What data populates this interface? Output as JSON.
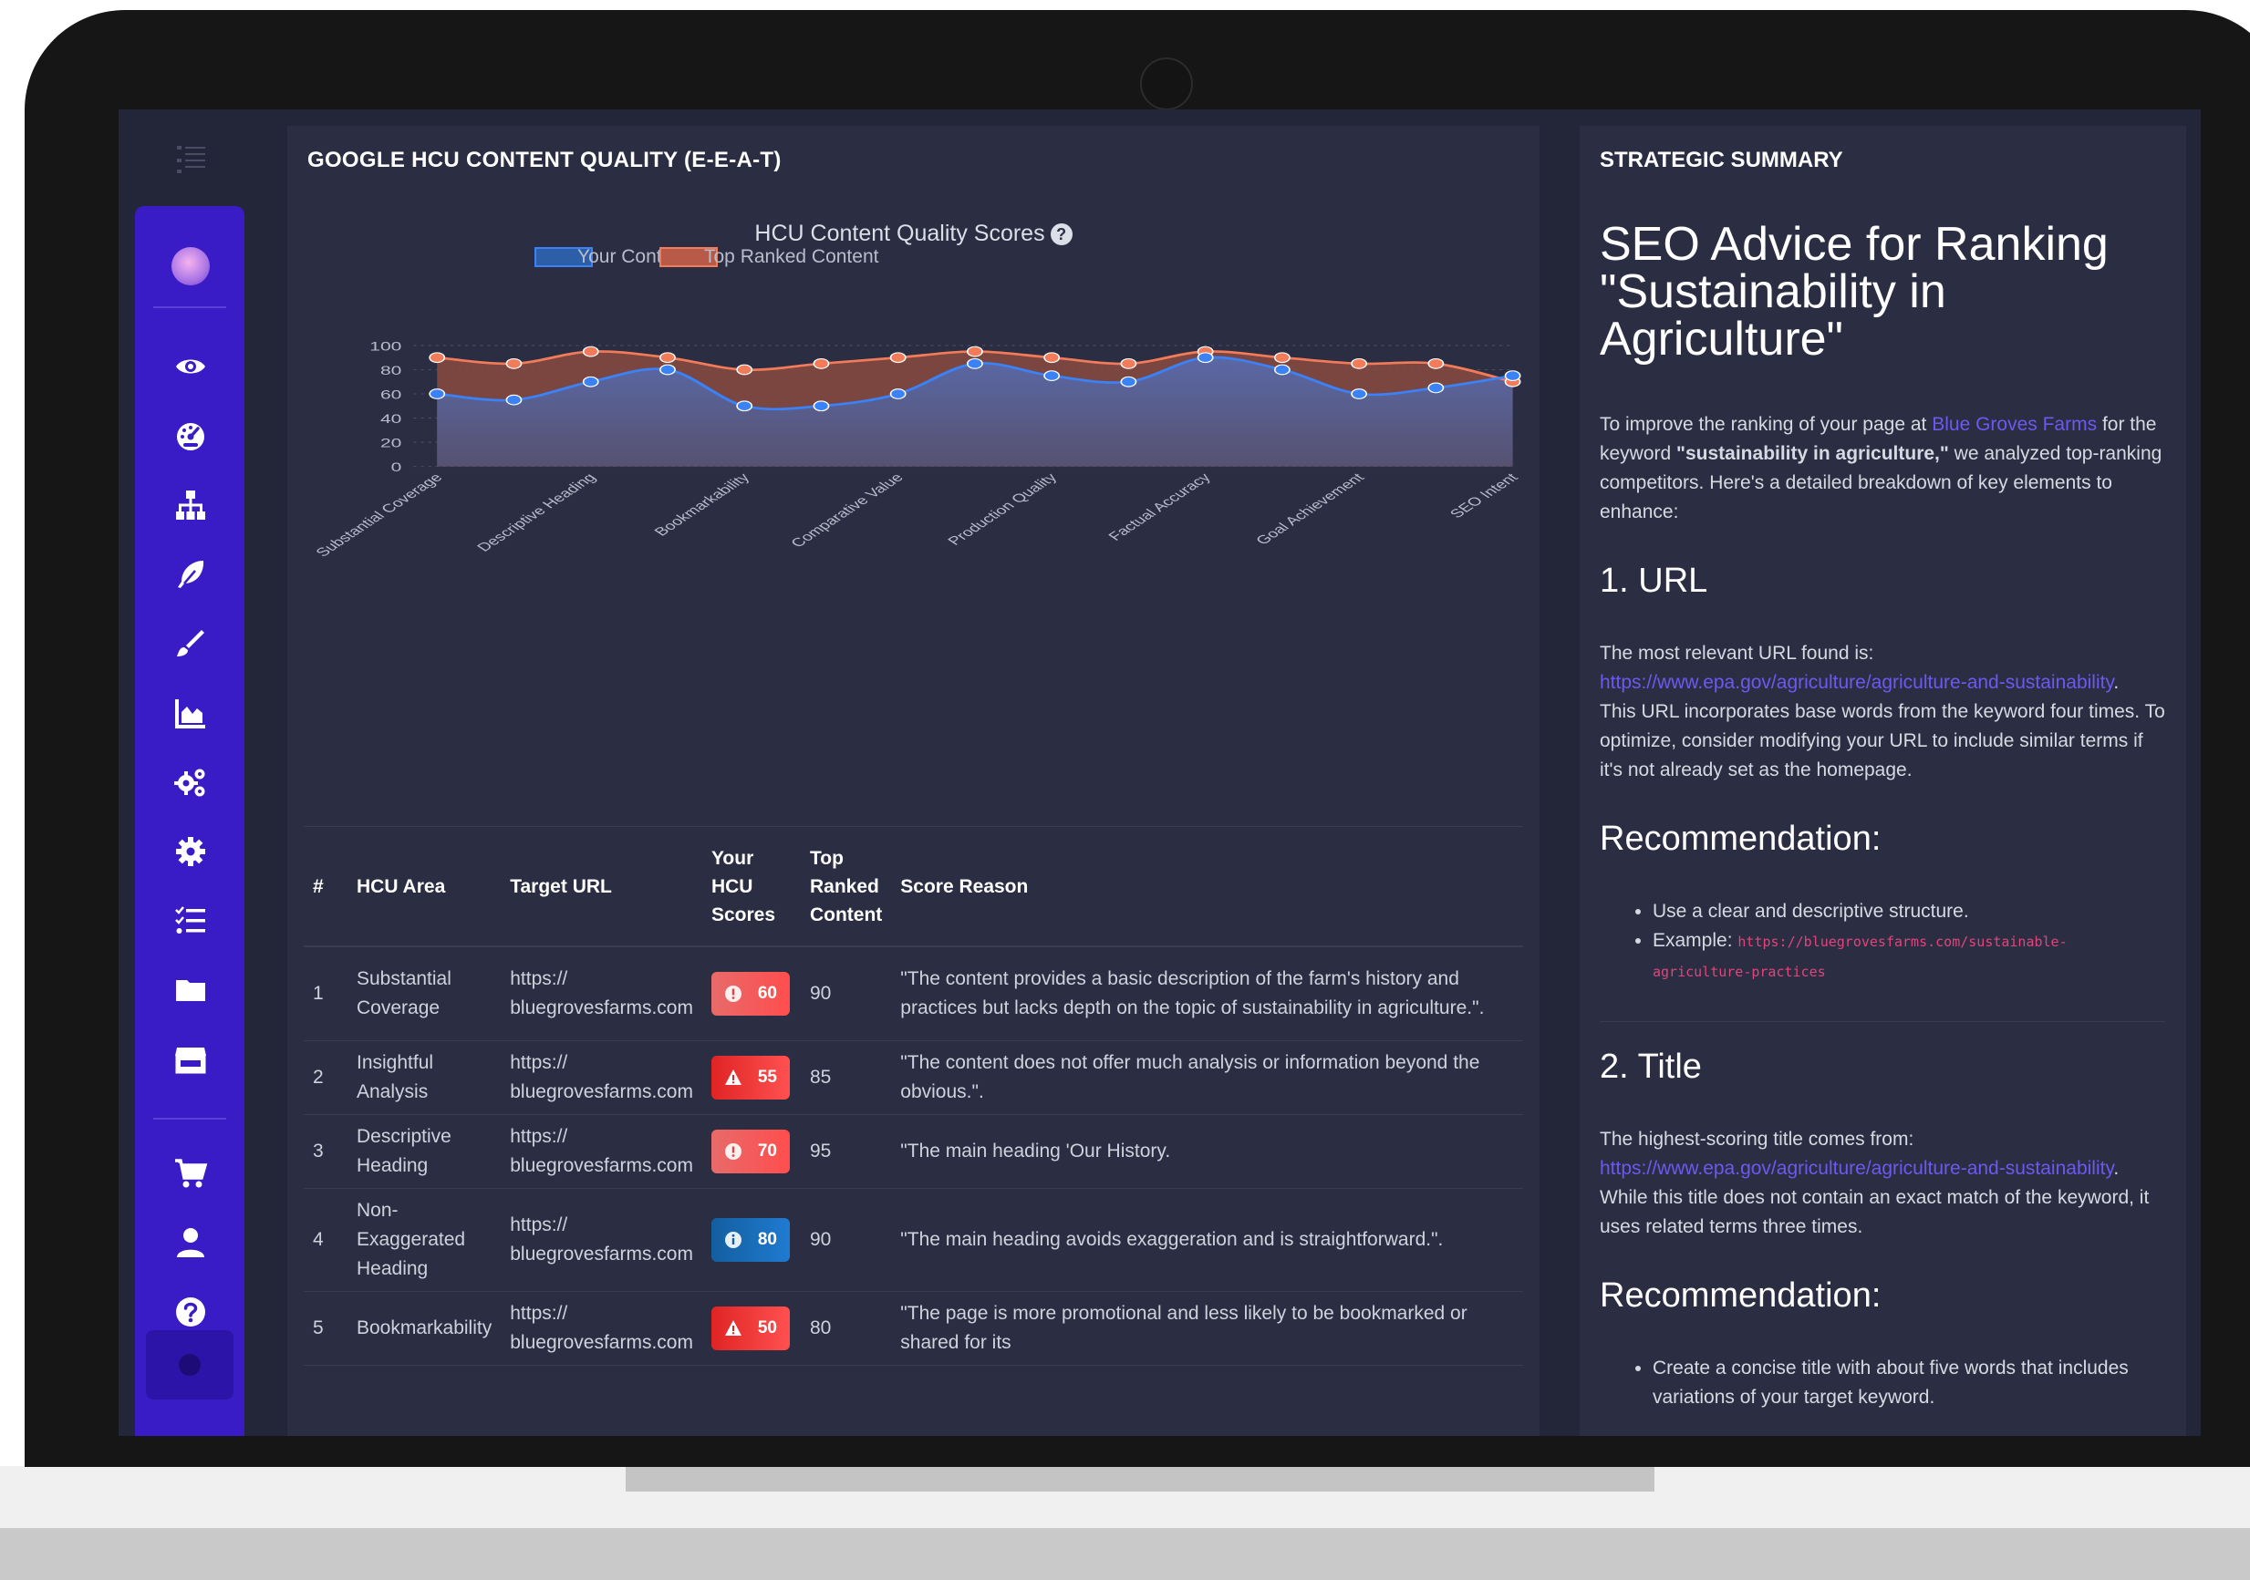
{
  "main": {
    "panel_title": "GOOGLE HCU CONTENT QUALITY (E-E-A-T)",
    "chart_title": "HCU Content Quality Scores",
    "table": {
      "headers": {
        "num": "#",
        "area": "HCU Area",
        "url": "Target URL",
        "yours": "Your HCU Scores",
        "top": "Top Ranked Content",
        "reason": "Score Reason"
      },
      "rows": [
        {
          "num": "1",
          "area": "Substantial Coverage",
          "url": "https:// bluegrovesfarms.com",
          "score": "60",
          "status": "info",
          "top": "90",
          "reason": "\"The content provides a basic description of the farm's history and practices but lacks depth on the topic of sustainability in agriculture.\"."
        },
        {
          "num": "2",
          "area": "Insightful Analysis",
          "url": "https:// bluegrovesfarms.com",
          "score": "55",
          "status": "warning",
          "top": "85",
          "reason": "\"The content does not offer much analysis or information beyond the obvious.\"."
        },
        {
          "num": "3",
          "area": "Descriptive Heading",
          "url": "https:// bluegrovesfarms.com",
          "score": "70",
          "status": "info",
          "top": "95",
          "reason": "\"The main heading 'Our History."
        },
        {
          "num": "4",
          "area": "Non-Exaggerated Heading",
          "url": "https:// bluegrovesfarms.com",
          "score": "80",
          "status": "good",
          "top": "90",
          "reason": "\"The main heading avoids exaggeration and is straightforward.\"."
        },
        {
          "num": "5",
          "area": "Bookmarkability",
          "url": "https:// bluegrovesfarms.com",
          "score": "50",
          "status": "warning",
          "top": "80",
          "reason": "\"The page is more promotional and less likely to be bookmarked or shared for its"
        }
      ]
    }
  },
  "chart_data": {
    "type": "area",
    "title": "HCU Content Quality Scores",
    "x_tick_labels": [
      "Substantial Coverage",
      "Descriptive Heading",
      "Bookmarkability",
      "Comparative Value",
      "Production Quality",
      "Factual Accuracy",
      "Goal Achievement",
      "SEO Intent"
    ],
    "ylim": [
      0,
      100
    ],
    "y_ticks": [
      0,
      20,
      40,
      60,
      80,
      100
    ],
    "grid": true,
    "legend": "top-center",
    "series": [
      {
        "name": "Your Content",
        "color": "#3b82f6",
        "values": [
          60,
          55,
          70,
          80,
          50,
          50,
          60,
          85,
          75,
          70,
          90,
          80,
          60,
          65,
          75
        ]
      },
      {
        "name": "Top Ranked Content",
        "color": "#f27c5a",
        "values": [
          90,
          85,
          95,
          90,
          80,
          85,
          90,
          95,
          90,
          85,
          95,
          90,
          85,
          85,
          70
        ]
      }
    ]
  },
  "summary": {
    "panel_title": "STRATEGIC SUMMARY",
    "heading": "SEO Advice for Ranking \"Sustainability in Agriculture\"",
    "intro_pre": "To improve the ranking of your page at ",
    "intro_link": "Blue Groves Farms",
    "intro_mid": " for the keyword ",
    "intro_keyword": "\"sustainability in agriculture,\"",
    "intro_post": " we analyzed top-ranking competitors. Here's a detailed breakdown of key elements to enhance:",
    "sec1_title": "1. URL",
    "sec1_found": "The most relevant URL found is:",
    "sec1_link": "https://www.epa.gov/agriculture/agriculture-and-sustainability",
    "sec1_body": "This URL incorporates base words from the keyword four times. To optimize, consider modifying your URL to include similar terms if it's not already set as the homepage.",
    "rec_title": "Recommendation:",
    "rec1_item1": "Use a clear and descriptive structure.",
    "rec1_item2_label": "Example:",
    "rec1_item2_code": "https://bluegrovesfarms.com/sustainable-agriculture-practices",
    "sec2_title": "2. Title",
    "sec2_found": "The highest-scoring title comes from:",
    "sec2_link": "https://www.epa.gov/agriculture/agriculture-and-sustainability",
    "sec2_body": "While this title does not contain an exact match of the keyword, it uses related terms three times.",
    "rec2_item1": "Create a concise title with about five words that includes variations of your target keyword."
  }
}
